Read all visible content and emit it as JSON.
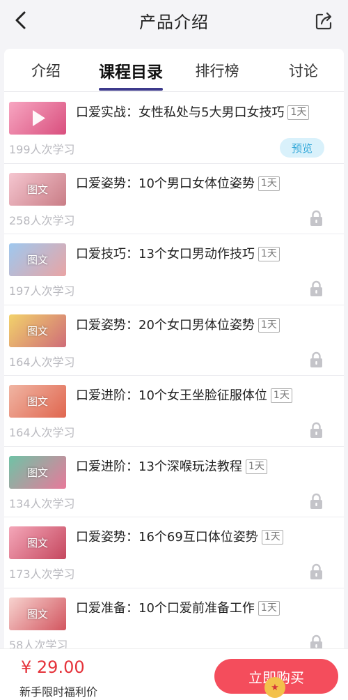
{
  "header": {
    "title": "产品介绍",
    "back_icon": "chevron-left-icon",
    "share_icon": "share-icon"
  },
  "tabs": [
    {
      "label": "介绍",
      "active": false
    },
    {
      "label": "课程目录",
      "active": true
    },
    {
      "label": "排行榜",
      "active": false
    },
    {
      "label": "讨论",
      "active": false
    }
  ],
  "courses": [
    {
      "title": "口爱实战：女性私处与5大男口女技巧",
      "days": "1天",
      "learners": "199人次学习",
      "thumb_label": "",
      "thumb_colors": [
        "#f7a6c1",
        "#d94f7e"
      ],
      "preview": "预览",
      "locked": false,
      "thumb_kind": "video"
    },
    {
      "title": "口爱姿势：10个男口女体位姿势",
      "days": "1天",
      "learners": "258人次学习",
      "thumb_label": "图文",
      "thumb_colors": [
        "#f5c6d0",
        "#c97d86"
      ],
      "locked": true
    },
    {
      "title": "口爱技巧：13个女口男动作技巧",
      "days": "1天",
      "learners": "197人次学习",
      "thumb_label": "图文",
      "thumb_colors": [
        "#9ec8ef",
        "#e9a4a4"
      ],
      "locked": true
    },
    {
      "title": "口爱姿势：20个女口男体位姿势",
      "days": "1天",
      "learners": "164人次学习",
      "thumb_label": "图文",
      "thumb_colors": [
        "#f2d26b",
        "#cf6c78"
      ],
      "locked": true
    },
    {
      "title": "口爱进阶：10个女王坐脸征服体位",
      "days": "1天",
      "learners": "164人次学习",
      "thumb_label": "图文",
      "thumb_colors": [
        "#f0b5a3",
        "#e0664f"
      ],
      "locked": true
    },
    {
      "title": "口爱进阶：13个深喉玩法教程",
      "days": "1天",
      "learners": "134人次学习",
      "thumb_label": "图文",
      "thumb_colors": [
        "#6fc3a6",
        "#e8799a"
      ],
      "locked": true
    },
    {
      "title": "口爱姿势：16个69互口体位姿势",
      "days": "1天",
      "learners": "173人次学习",
      "thumb_label": "图文",
      "thumb_colors": [
        "#f4a7b9",
        "#c5475e"
      ],
      "locked": true
    },
    {
      "title": "口爱准备：10个口爱前准备工作",
      "days": "1天",
      "learners": "58人次学习",
      "thumb_label": "图文",
      "thumb_colors": [
        "#f7d3cf",
        "#d2555f"
      ],
      "locked": true
    }
  ],
  "footer": {
    "price": "¥ 29.00",
    "promo": "新手限时福利价",
    "buy_label": "立即购买"
  },
  "colors": {
    "accent": "#3d3a8c",
    "price": "#e5333b",
    "buy": "#f44d5c",
    "preview_bg": "#d9f1fb",
    "preview_text": "#31a7d8"
  }
}
